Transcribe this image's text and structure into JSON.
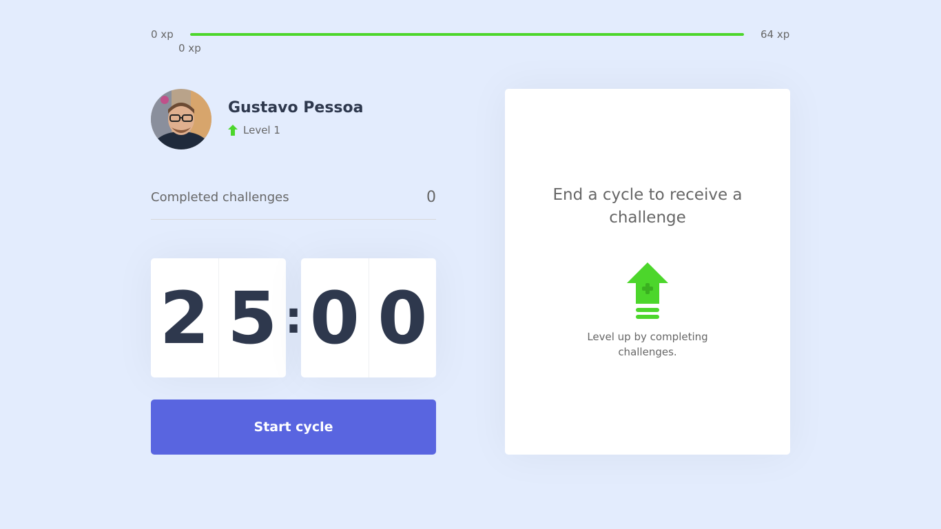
{
  "experience": {
    "min_label": "0 xp",
    "max_label": "64 xp",
    "current_label": "0 xp",
    "progress_fraction": 1.0,
    "bar_color": "#4cd62b"
  },
  "profile": {
    "name": "Gustavo Pessoa",
    "level_label": "Level 1",
    "level_icon": "level-up-arrow-icon"
  },
  "challenges_completed": {
    "label": "Completed challenges",
    "value": "0"
  },
  "countdown": {
    "minute_left": "2",
    "minute_right": "5",
    "separator": ":",
    "second_left": "0",
    "second_right": "0"
  },
  "start_button": {
    "label": "Start cycle",
    "color": "#5965e0"
  },
  "challenge_box": {
    "title_line1": "End a cycle to receive a",
    "title_line2": "challenge",
    "icon": "level-up-icon",
    "hint_line1": "Level up by completing",
    "hint_line2": "challenges."
  }
}
